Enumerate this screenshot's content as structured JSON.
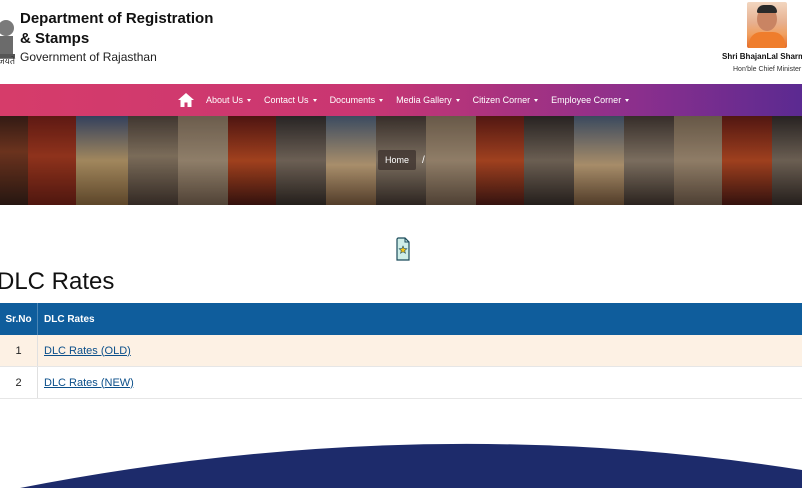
{
  "header": {
    "dept_title": "Department of Registration & Stamps",
    "dept_subtitle": "Government of Rajasthan",
    "emblem_text": "जयते",
    "cm_name": "Shri BhajanLal Sharma",
    "cm_role": "Hon'ble Chief Minister"
  },
  "nav": {
    "items": [
      {
        "label": "About Us"
      },
      {
        "label": "Contact Us"
      },
      {
        "label": "Documents"
      },
      {
        "label": "Media Gallery"
      },
      {
        "label": "Citizen Corner"
      },
      {
        "label": "Employee Corner"
      }
    ]
  },
  "breadcrumb": {
    "home": "Home",
    "separator": "/"
  },
  "page": {
    "title": "DLC Rates"
  },
  "table": {
    "headers": [
      "Sr.No",
      "DLC Rates"
    ],
    "rows": [
      {
        "srno": "1",
        "label": "DLC Rates (OLD)"
      },
      {
        "srno": "2",
        "label": "DLC Rates (NEW)"
      }
    ]
  },
  "colors": {
    "nav_start": "#d63c6a",
    "nav_end": "#5b2a91",
    "table_header": "#0f5d9c",
    "row_highlight": "#fdf1e4",
    "link": "#0b4f8a",
    "footer_arc": "#1d2b6b"
  },
  "icons": {
    "home": "home-icon",
    "star_doc": "star-document-icon",
    "emblem": "state-emblem-icon"
  }
}
